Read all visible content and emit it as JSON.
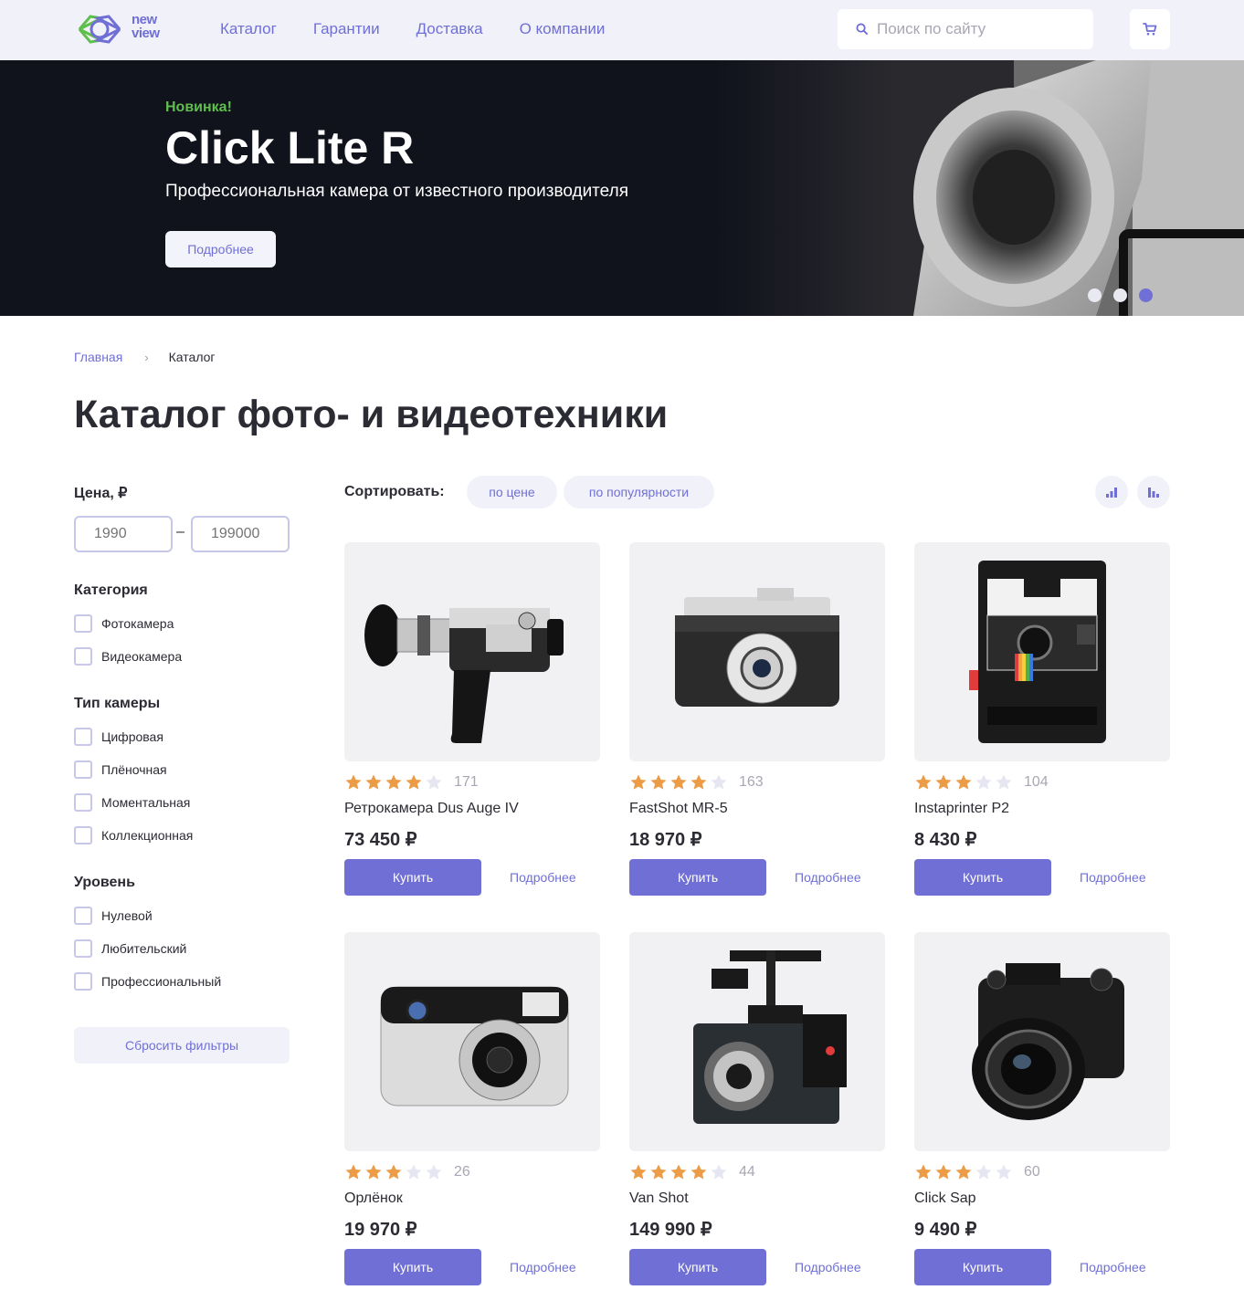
{
  "header": {
    "logo_top": "new",
    "logo_bottom": "view",
    "nav": [
      "Каталог",
      "Гарантии",
      "Доставка",
      "О компании"
    ],
    "search_placeholder": "Поиск по сайту"
  },
  "hero": {
    "badge": "Новинка!",
    "title": "Click Lite R",
    "subtitle": "Профессиональная камера от известного производителя",
    "button": "Подробнее",
    "slides_total": 3,
    "active_slide": 3
  },
  "breadcrumb": {
    "home": "Главная",
    "current": "Каталог"
  },
  "page_title": "Каталог фото- и видеотехники",
  "filters": {
    "price_label": "Цена, ₽",
    "price_min_placeholder": "1990",
    "price_max_placeholder": "199000",
    "price_dash": "–",
    "groups": [
      {
        "title": "Категория",
        "options": [
          "Фотокамера",
          "Видеокамера"
        ]
      },
      {
        "title": "Тип камеры",
        "options": [
          "Цифровая",
          "Плёночная",
          "Моментальная",
          "Коллекционная"
        ]
      },
      {
        "title": "Уровень",
        "options": [
          "Нулевой",
          "Любительский",
          "Профессиональный"
        ]
      }
    ],
    "reset": "Сбросить фильтры"
  },
  "sort": {
    "label": "Сортировать:",
    "options": [
      "по цене",
      "по популярности"
    ]
  },
  "products": [
    {
      "name": "Ретрокамера Dus Auge IV",
      "price": "73 450 ₽",
      "rating": 4,
      "reviews": "171",
      "buy": "Купить",
      "more": "Подробнее"
    },
    {
      "name": "FastShot MR-5",
      "price": "18 970 ₽",
      "rating": 4,
      "reviews": "163",
      "buy": "Купить",
      "more": "Подробнее"
    },
    {
      "name": "Instaprinter P2",
      "price": "8 430 ₽",
      "rating": 3,
      "reviews": "104",
      "buy": "Купить",
      "more": "Подробнее"
    },
    {
      "name": "Орлёнок",
      "price": "19 970 ₽",
      "rating": 3,
      "reviews": "26",
      "buy": "Купить",
      "more": "Подробнее"
    },
    {
      "name": "Van Shot",
      "price": "149 990 ₽",
      "rating": 4,
      "reviews": "44",
      "buy": "Купить",
      "more": "Подробнее"
    },
    {
      "name": "Click Sap",
      "price": "9 490 ₽",
      "rating": 3,
      "reviews": "60",
      "buy": "Купить",
      "more": "Подробнее"
    }
  ],
  "colors": {
    "accent": "#6f6fd6",
    "header_bg": "#f1f1fa",
    "hero_bg": "#10121c",
    "new_badge": "#5fbf4c",
    "star_filled": "#ec9b46",
    "star_empty": "#e6e6f2"
  }
}
